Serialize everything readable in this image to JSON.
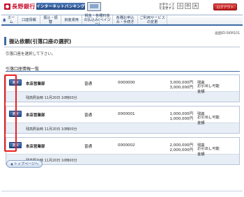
{
  "header": {
    "bank_name": "長野銀行",
    "service_banner": "インターネットバンキング",
    "font_size_label": "文字サイズを変更する",
    "font_sizes": [
      "小",
      "中",
      "大"
    ],
    "logout_label": "ログアウト"
  },
  "nav": {
    "items": [
      "ホーム",
      "口座情報",
      "振込・振替",
      "資産運用",
      "税金・各種料金の払込み(ペイジー)",
      "各種お申込み・手続き",
      "ご利用サービスの変更"
    ]
  },
  "screen_id": "画面ID:SKM101",
  "page": {
    "title": "振込依頼(引落口座の選択)",
    "instruction": "引落口座を選択して下さい。",
    "section_title": "引落口座情報一覧"
  },
  "accounts": [
    {
      "select_label": "選択",
      "branch": "本店営業部",
      "type": "普通",
      "number": "0000000",
      "balance": "3,000,000円",
      "available": "3,000,000円",
      "balance_label": "残高",
      "available_label": "お引出し可能",
      "available_label2": "金額",
      "as_of": "残高照会時 11月20日 10時00分"
    },
    {
      "select_label": "選択",
      "branch": "本店営業部",
      "type": "普通",
      "number": "0000001",
      "balance": "1,000,000円",
      "available": "1,000,000円",
      "balance_label": "残高",
      "available_label": "お引出し可能",
      "available_label2": "金額",
      "as_of": "残高照会時 11月20日 10時00分"
    },
    {
      "select_label": "選択",
      "branch": "本店営業部",
      "type": "普通",
      "number": "0000002",
      "balance": "2,000,000円",
      "available": "2,000,000円",
      "balance_label": "残高",
      "available_label": "お引出し可能",
      "available_label2": "金額",
      "as_of": "残高照会時 11月20日 10時00分"
    }
  ],
  "top_button_label": "トップページへ",
  "colors": {
    "brand_red": "#c8102e",
    "nav_blue": "#3e6aa6",
    "highlight_red": "#e8201c"
  }
}
